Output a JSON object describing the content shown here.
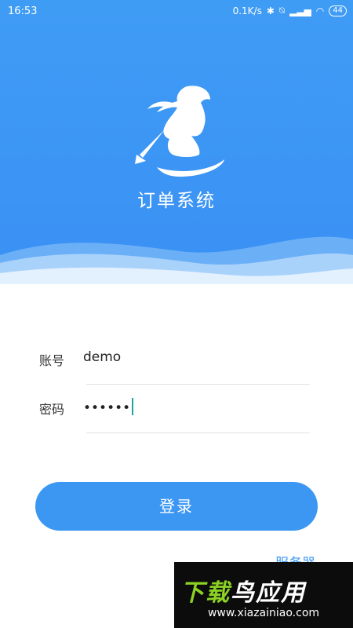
{
  "status_bar": {
    "time": "16:53",
    "network_speed": "0.1K/s",
    "battery": "44"
  },
  "app": {
    "title": "订单系统"
  },
  "form": {
    "username": {
      "label": "账号",
      "value": "demo"
    },
    "password": {
      "label": "密码",
      "value": "••••••"
    }
  },
  "login_button": {
    "label": "登录"
  },
  "server_link": {
    "label": "服务器"
  },
  "watermark": {
    "title_part1": "下载",
    "title_part2": "鸟应用",
    "url": "www.xiazainiao.com"
  },
  "colors": {
    "primary": "#3b97f2",
    "cursor": "#1aa5a0"
  }
}
